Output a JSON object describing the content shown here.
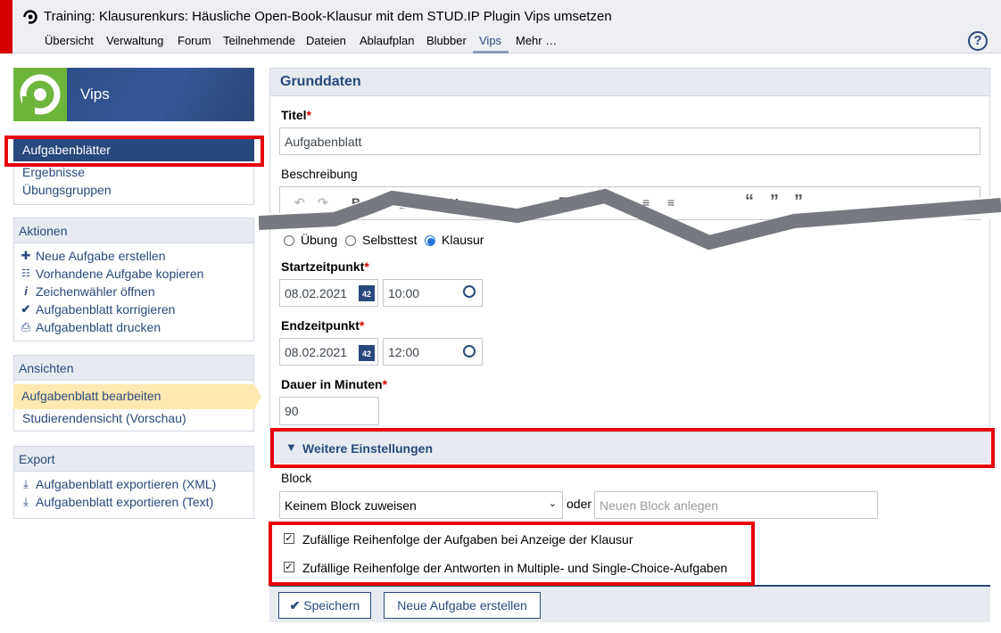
{
  "header": {
    "course_title": "Training: Klausurenkurs: Häusliche Open-Book-Klausur mit dem STUD.IP Plugin Vips umsetzen",
    "nav": [
      "Übersicht",
      "Verwaltung",
      "Forum",
      "Teilnehmende",
      "Dateien",
      "Ablaufplan",
      "Blubber",
      "Vips",
      "Mehr …"
    ],
    "active_nav": "Vips",
    "help_icon": "?"
  },
  "sidebar": {
    "logo_label": "Vips",
    "nav_items": [
      "Aufgabenblätter",
      "Ergebnisse",
      "Übungsgruppen"
    ],
    "aktionen": {
      "title": "Aktionen",
      "items": [
        {
          "label": "Neue Aufgabe erstellen",
          "icon": "plus-icon"
        },
        {
          "label": "Vorhandene Aufgabe kopieren",
          "icon": "copy-list-icon"
        },
        {
          "label": "Zeichenwähler öffnen",
          "icon": "info-icon"
        },
        {
          "label": "Aufgabenblatt korrigieren",
          "icon": "check-icon"
        },
        {
          "label": "Aufgabenblatt drucken",
          "icon": "print-icon"
        }
      ]
    },
    "ansichten": {
      "title": "Ansichten",
      "items": [
        "Aufgabenblatt bearbeiten",
        "Studierendensicht (Vorschau)"
      ]
    },
    "export": {
      "title": "Export",
      "items": [
        "Aufgabenblatt exportieren (XML)",
        "Aufgabenblatt exportieren (Text)"
      ]
    }
  },
  "form": {
    "section_title": "Grunddaten",
    "titel_label": "Titel",
    "titel_value": "Aufgabenblatt",
    "beschreibung_label": "Beschreibung",
    "mode_options": [
      "Übung",
      "Selbsttest",
      "Klausur"
    ],
    "selected_mode": "Klausur",
    "start_label": "Startzeitpunkt",
    "start_date": "08.02.2021",
    "start_time": "10:00",
    "end_label": "Endzeitpunkt",
    "end_date": "08.02.2021",
    "end_time": "12:00",
    "dauer_label": "Dauer in Minuten",
    "dauer_value": "90",
    "calendar_badge": "42",
    "required_mark": "*",
    "weitere_label": "Weitere Einstellungen",
    "block_label": "Block",
    "block_select": "Keinem Block zuweisen",
    "oder": "oder",
    "new_block_placeholder": "Neuen Block anlegen",
    "check_random_tasks": "Zufällige Reihenfolge der Aufgaben bei Anzeige der Klausur",
    "check_random_answers": "Zufällige Reihenfolge der Antworten in Multiple- und Single-Choice-Aufgaben",
    "random_tasks_checked": true,
    "random_answers_checked": true
  },
  "buttons": {
    "save": "Speichern",
    "new_task": "Neue Aufgabe erstellen"
  },
  "colors": {
    "accent": "#28497c",
    "highlight": "#e8000d",
    "selected_item": "#ffe9b0"
  }
}
